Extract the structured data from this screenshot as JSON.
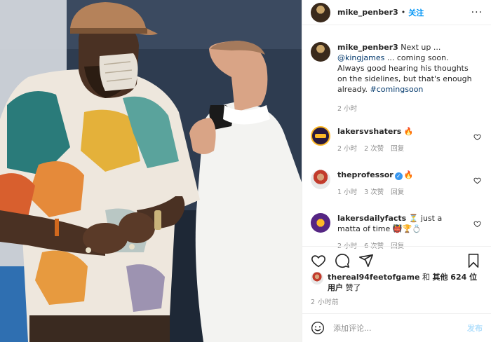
{
  "header": {
    "username": "mike_penber3",
    "dot": "•",
    "follow_label": "关注",
    "more_label": "···"
  },
  "caption": {
    "username": "mike_penber3",
    "text_before": "Next up ... ",
    "mention": "@kingjames",
    "text_after": " ... coming soon. Always good hearing his thoughts on the sidelines, but that's enough already. ",
    "hashtag": "#comingsoon",
    "time": "2 小时"
  },
  "comments": [
    {
      "username": "lakersvshaters",
      "text": "🔥",
      "time": "2 小时",
      "likes": "2 次赞",
      "reply": "回复"
    },
    {
      "username": "theprofessor",
      "verified_mark": "✓",
      "text": "🔥",
      "time": "1 小时",
      "likes": "3 次赞",
      "reply": "回复"
    },
    {
      "username": "lakersdailyfacts",
      "text": "⏳ just a matta of time 👹🏆💍",
      "time": "2 小时",
      "likes": "6 次赞",
      "reply": "回复"
    }
  ],
  "likes": {
    "username": "thereal94feetofgame",
    "connector": " 和 ",
    "others": "其他 624 位用户",
    "suffix": "赞了"
  },
  "post_time": "2 小时前",
  "comment_box": {
    "placeholder": "添加评论...",
    "post_label": "发布"
  },
  "colors": {
    "accent_blue": "#0095f6",
    "link_blue": "#00376b",
    "muted_gray": "#8e8e8e",
    "post_disabled": "#b2dffc"
  },
  "icons": [
    "more-options-icon",
    "heart-icon",
    "comment-icon",
    "share-icon",
    "bookmark-icon",
    "emoji-icon",
    "verified-icon"
  ]
}
